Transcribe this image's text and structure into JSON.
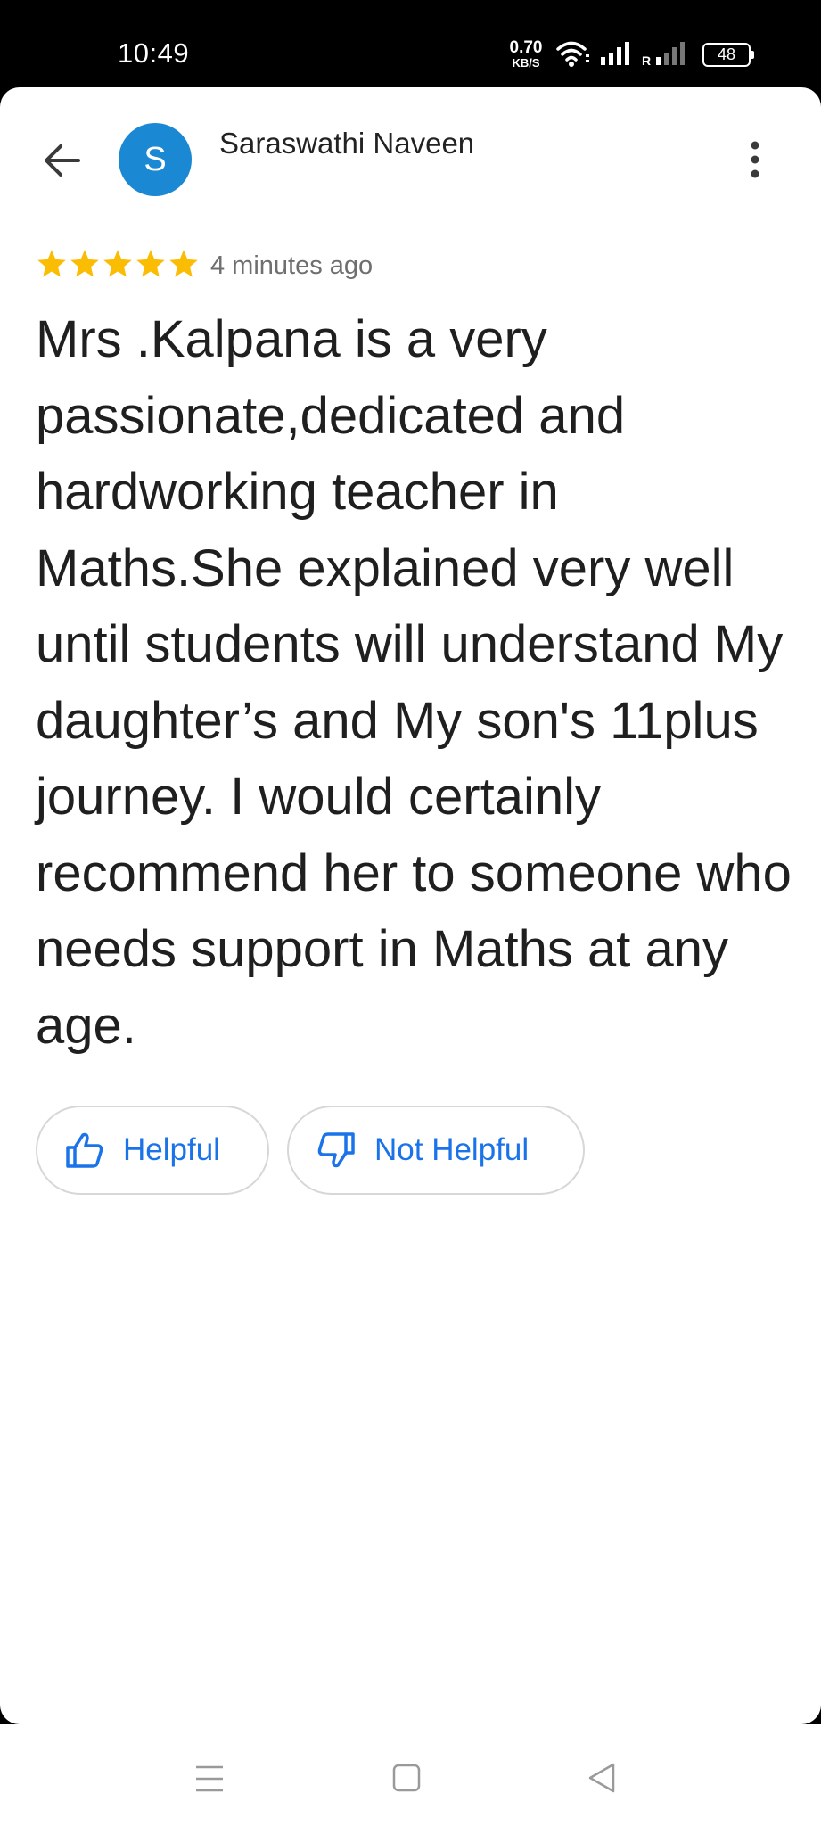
{
  "status_bar": {
    "time": "10:49",
    "net_speed_value": "0.70",
    "net_speed_unit": "KB/S",
    "sim2_label": "R",
    "battery": "48",
    "icons": [
      "wifi-icon",
      "signal-icon",
      "signal-icon",
      "battery-icon"
    ]
  },
  "header": {
    "avatar_letter": "S",
    "avatar_color": "#1b88d4",
    "author_name": "Saraswathi Naveen"
  },
  "review": {
    "rating": 5,
    "max_rating": 5,
    "star_color": "#fbbc04",
    "time_ago": "4 minutes ago",
    "text": "Mrs .Kalpana is a very passionate,dedicated and hardworking teacher in Maths.She explained very well until students will understand My daughter’s and My son's 11plus journey. I would certainly recommend her to someone who needs support in Maths at any age."
  },
  "actions": {
    "helpful_label": "Helpful",
    "not_helpful_label": "Not Helpful",
    "accent_color": "#1a73e8"
  },
  "nav_bar": {
    "icons": [
      "menu-icon",
      "home-icon",
      "back-triangle-icon"
    ]
  }
}
